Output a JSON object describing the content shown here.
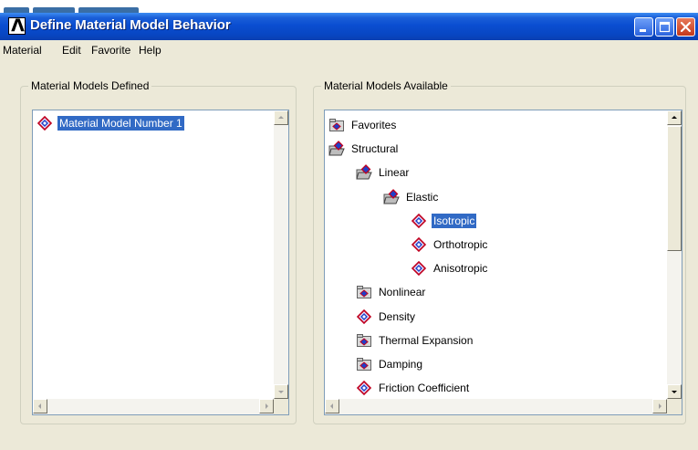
{
  "window": {
    "title": "Define Material Model Behavior",
    "app_logo": "Λ"
  },
  "menu": [
    "Material",
    "Edit",
    "Favorite",
    "Help"
  ],
  "left_group": {
    "title": "Material Models Defined",
    "items": [
      {
        "label": "Material Model Number 1",
        "icon": "material-model-icon",
        "selected": true
      }
    ]
  },
  "right_group": {
    "title": "Material Models Available",
    "tree": [
      {
        "label": "Favorites",
        "icon": "folder-icon",
        "level": 0
      },
      {
        "label": "Structural",
        "icon": "open-folder-icon",
        "level": 0
      },
      {
        "label": "Linear",
        "icon": "open-folder-icon",
        "level": 1
      },
      {
        "label": "Elastic",
        "icon": "open-folder-icon",
        "level": 2
      },
      {
        "label": "Isotropic",
        "icon": "material-model-icon",
        "level": 3,
        "selected": true
      },
      {
        "label": "Orthotropic",
        "icon": "material-model-icon",
        "level": 3
      },
      {
        "label": "Anisotropic",
        "icon": "material-model-icon",
        "level": 3
      },
      {
        "label": "Nonlinear",
        "icon": "folder-icon",
        "level": 1
      },
      {
        "label": "Density",
        "icon": "material-model-icon",
        "level": 1
      },
      {
        "label": "Thermal Expansion",
        "icon": "folder-icon",
        "level": 1
      },
      {
        "label": "Damping",
        "icon": "folder-icon",
        "level": 1
      },
      {
        "label": "Friction Coefficient",
        "icon": "material-model-icon",
        "level": 1
      }
    ]
  },
  "colors": {
    "titlebar": "#0a4ed1",
    "selection": "#316ac5",
    "dialog_bg": "#ece9d8"
  }
}
